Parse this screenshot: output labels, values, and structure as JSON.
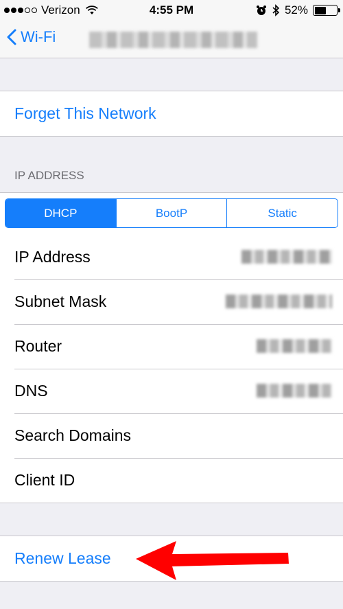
{
  "status_bar": {
    "carrier": "Verizon",
    "time": "4:55 PM",
    "battery": "52%",
    "battery_level": 0.52,
    "signal_bars_filled": 3,
    "signal_bars_total": 5
  },
  "nav": {
    "back_label": "Wi-Fi"
  },
  "actions": {
    "forget_network": "Forget This Network",
    "renew_lease": "Renew Lease"
  },
  "ip_section": {
    "header": "IP ADDRESS",
    "segments": [
      "DHCP",
      "BootP",
      "Static"
    ],
    "selected_segment": "DHCP"
  },
  "rows": {
    "ip_address": "IP Address",
    "subnet_mask": "Subnet Mask",
    "router": "Router",
    "dns": "DNS",
    "search_domains": "Search Domains",
    "client_id": "Client ID"
  },
  "colors": {
    "ios_blue": "#157efb",
    "background": "#efeff4",
    "arrow_red": "#ff0000"
  }
}
